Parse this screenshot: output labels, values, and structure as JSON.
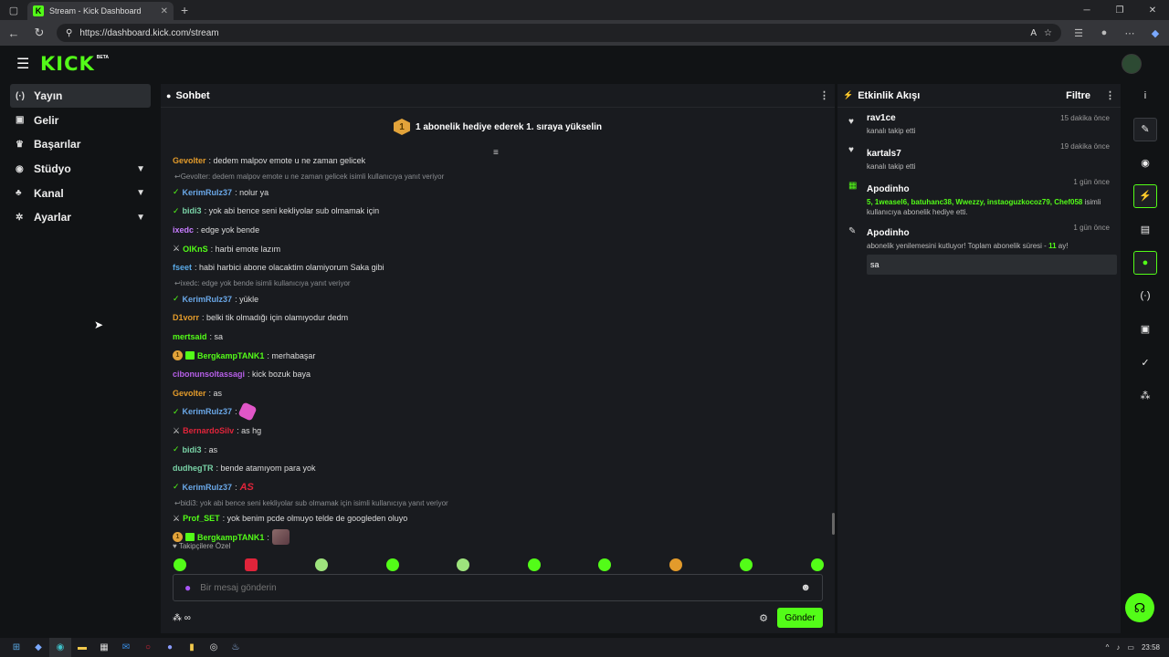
{
  "browser": {
    "tab_title": "Stream - Kick Dashboard",
    "url": "https://dashboard.kick.com/stream"
  },
  "header": {
    "logo": "KICK",
    "beta": "BETA"
  },
  "sidebar": {
    "items": [
      {
        "icon": "(·)",
        "label": "Yayın",
        "chevron": false,
        "active": true
      },
      {
        "icon": "▣",
        "label": "Gelir",
        "chevron": false
      },
      {
        "icon": "♛",
        "label": "Başarılar",
        "chevron": false
      },
      {
        "icon": "◉",
        "label": "Stüdyo",
        "chevron": true
      },
      {
        "icon": "♣",
        "label": "Kanal",
        "chevron": true
      },
      {
        "icon": "✲",
        "label": "Ayarlar",
        "chevron": true
      }
    ]
  },
  "chat": {
    "title": "Sohbet",
    "pinned_badge": "1",
    "pinned_text": "1 abonelik hediye ederek 1. sıraya yükselin",
    "messages": [
      {
        "type": "msg",
        "user": "Gevolter",
        "color": "#e39b2b",
        "text": ": dedem malpov emote u ne zaman gelicek"
      },
      {
        "type": "reply",
        "text": "Gevolter: dedem malpov emote u ne zaman gelicek isimli kullanıcıya yanıt veriyor"
      },
      {
        "type": "msg",
        "badge": "mod",
        "user": "KerimRulz37",
        "color": "#6aa8e8",
        "text": ": nolur ya"
      },
      {
        "type": "msg",
        "badge": "mod",
        "user": "bidi3",
        "color": "#79d2a6",
        "text": ": yok abi bence seni kekliyolar sub olmamak için"
      },
      {
        "type": "msg",
        "user": "ixedc",
        "color": "#c77dff",
        "text": ": edge yok bende"
      },
      {
        "type": "msg",
        "badge": "sword",
        "user": "OlKnS",
        "color": "#53fc18",
        "text": ": harbi emote lazım"
      },
      {
        "type": "msg",
        "user": "fseet",
        "color": "#5aa9e6",
        "text": ": habi harbici abone olacaktim olamiyorum Saka gibi"
      },
      {
        "type": "reply",
        "text": "ixedc: edge yok bende isimli kullanıcıya yanıt veriyor"
      },
      {
        "type": "msg",
        "badge": "mod",
        "user": "KerimRulz37",
        "color": "#6aa8e8",
        "text": ": yükle"
      },
      {
        "type": "msg",
        "user": "D1vorr",
        "color": "#e39b2b",
        "text": ": belki tik olmadığı için olamıyodur dedm"
      },
      {
        "type": "msg",
        "user": "mertsaid",
        "color": "#53fc18",
        "text": ": sa"
      },
      {
        "type": "msg",
        "badge": "num-gift",
        "user": "BergkampTANK1",
        "color": "#53fc18",
        "text": ": merhabaşar"
      },
      {
        "type": "msg",
        "user": "cibonunsoltassagi",
        "color": "#b65fe8",
        "text": ": kick bozuk baya"
      },
      {
        "type": "msg",
        "user": "Gevolter",
        "color": "#e39b2b",
        "text": ": as"
      },
      {
        "type": "msg",
        "badge": "mod",
        "user": "KerimRulz37",
        "color": "#6aa8e8",
        "text": ":",
        "emote": "pink"
      },
      {
        "type": "msg",
        "badge": "sword",
        "user": "BernardoSilv",
        "color": "#e0243a",
        "text": ": as hg"
      },
      {
        "type": "msg",
        "badge": "mod",
        "user": "bidi3",
        "color": "#79d2a6",
        "text": ": as"
      },
      {
        "type": "msg",
        "user": "dudhegTR",
        "color": "#79d2a6",
        "text": ": bende atamıyom para yok"
      },
      {
        "type": "msg",
        "badge": "mod",
        "user": "KerimRulz37",
        "color": "#6aa8e8",
        "text": ":",
        "emote": "as",
        "emote_text": "AS"
      },
      {
        "type": "reply",
        "text": "bidi3: yok abi bence seni kekliyolar sub olmamak için isimli kullanıcıya yanıt veriyor"
      },
      {
        "type": "msg",
        "badge": "sword",
        "user": "Prof_SET",
        "color": "#53fc18",
        "text": ": yok benim pcde olmuyo telde de googleden oluyo"
      },
      {
        "type": "msg",
        "badge": "num-gift",
        "user": "BergkampTANK1",
        "color": "#53fc18",
        "text": ":",
        "emote": "img"
      }
    ],
    "followers_only": "♥ Takipçilere Özel",
    "input_placeholder": "Bir mesaj gönderin",
    "send_label": "Gönder"
  },
  "feed": {
    "title": "Etkinlik Akışı",
    "filter": "Filtre",
    "items": [
      {
        "icon": "♥",
        "icon_color": "#ddd",
        "name": "rav1ce",
        "time": "15 dakika önce",
        "desc": "kanalı takip etti"
      },
      {
        "icon": "♥",
        "icon_color": "#ddd",
        "name": "kartals7",
        "time": "19 dakika önce",
        "desc": "kanalı takip etti"
      },
      {
        "icon": "▦",
        "icon_color": "#53fc18",
        "name": "Apodinho",
        "time": "1 gün önce",
        "desc_hl": "5, 1weasel6, batuhanc38, Wwezzy, instaoguzkocoz79, Chef058",
        "desc": " isimli kullanıcıya abonelik hediye etti."
      },
      {
        "icon": "✎",
        "icon_color": "#ddd",
        "name": "Apodinho",
        "time": "1 gün önce",
        "desc": "abonelik yenilemesini kutluyor! Toplam abonelik süresi - ",
        "desc_hl2": "11",
        "desc_tail": " ay!",
        "box": "sa"
      }
    ]
  },
  "rail": [
    "i",
    "✎",
    "◉",
    "⚡",
    "▤",
    "●",
    "(·)",
    "▣",
    "✓",
    "⁂"
  ],
  "taskbar": {
    "time": "23:58"
  }
}
